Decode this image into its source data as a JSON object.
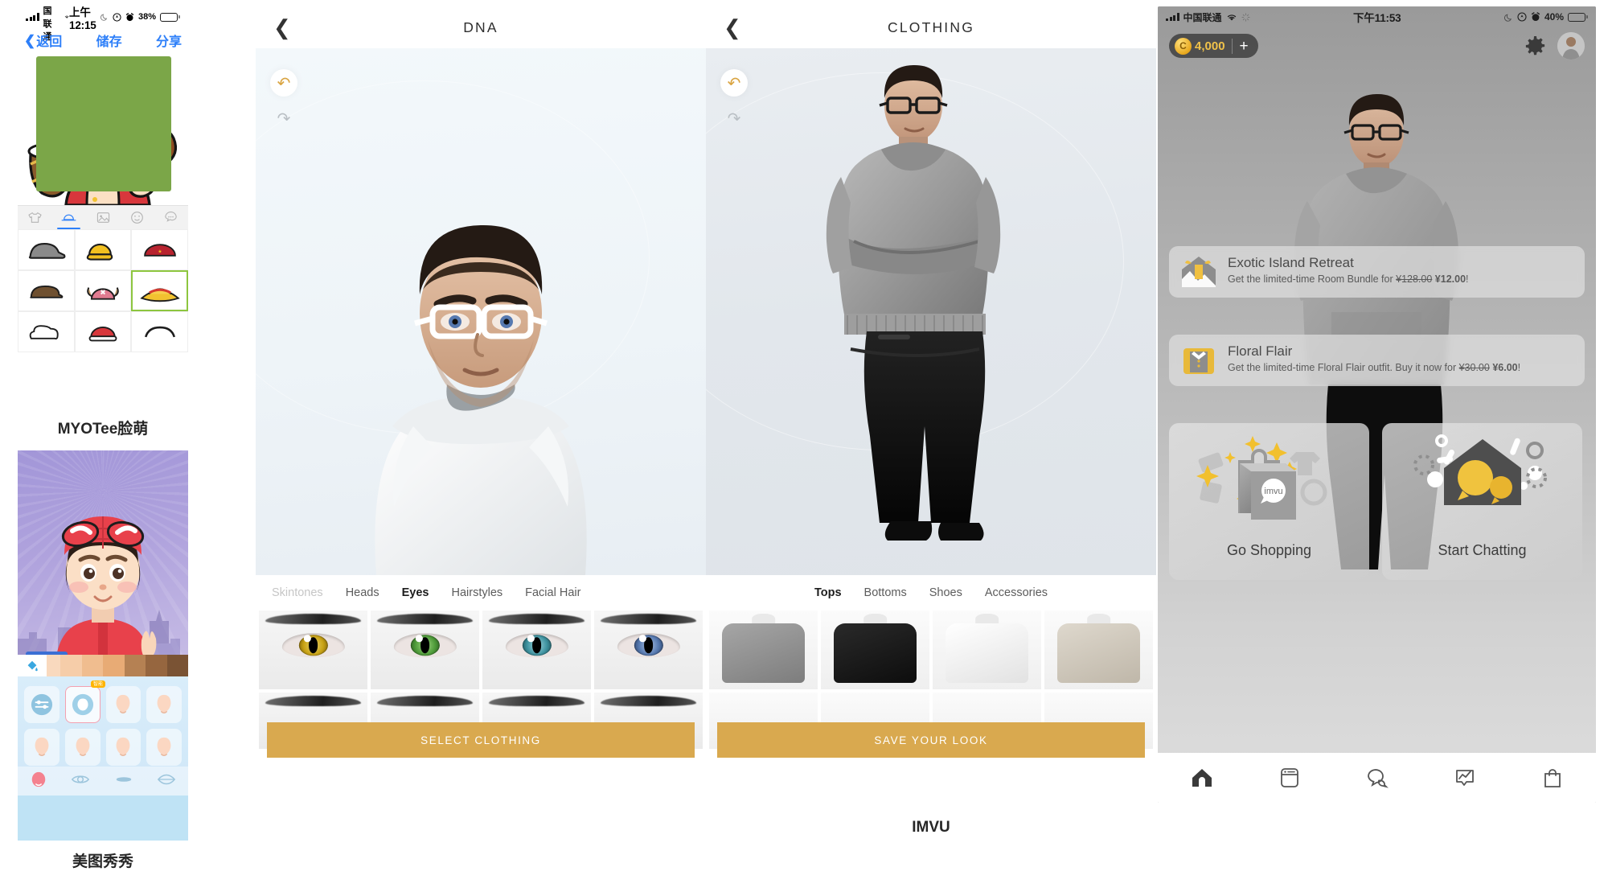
{
  "panels": {
    "myotee": {
      "app_label": "MYOTee脸萌",
      "statusbar": {
        "carrier": "中国联通",
        "time": "上午12:15",
        "battery": "38%"
      },
      "nav": {
        "back": "返回",
        "save": "储存",
        "share": "分享"
      },
      "tabs": [
        {
          "icon": "shirt-icon",
          "active": false
        },
        {
          "icon": "hat-icon",
          "active": true
        },
        {
          "icon": "image-icon",
          "active": false
        },
        {
          "icon": "face-icon",
          "active": false
        },
        {
          "icon": "speech-bubble-icon",
          "active": false
        }
      ],
      "items": [
        {
          "name": "grey-flat-cap",
          "selected": false
        },
        {
          "name": "yellow-ball-cap",
          "selected": false
        },
        {
          "name": "red-cap",
          "selected": false
        },
        {
          "name": "brown-newsboy-cap",
          "selected": false
        },
        {
          "name": "pink-reindeer-hat",
          "selected": false
        },
        {
          "name": "straw-hat",
          "selected": true
        },
        {
          "name": "white-fluffy-hat",
          "selected": false
        },
        {
          "name": "red-white-beanie",
          "selected": false
        },
        {
          "name": "black-headband",
          "selected": false
        }
      ]
    },
    "meitu": {
      "app_label": "美图秀秀",
      "bucket_icon": "paint-bucket-icon",
      "swatches": [
        "#fbe2cd",
        "#f9d9be",
        "#f6cda9",
        "#f0bd8f",
        "#e8ab75",
        "#b58153",
        "#96663f",
        "#7a5334"
      ],
      "items": [
        {
          "icon": "sliders-icon",
          "selected": false,
          "badge": ""
        },
        {
          "icon": "face-shape-icon",
          "selected": true,
          "badge": "智能"
        },
        {
          "icon": "face-shape-icon",
          "selected": false,
          "badge": ""
        },
        {
          "icon": "face-shape-icon",
          "selected": false,
          "badge": ""
        },
        {
          "icon": "face-shape-icon",
          "selected": false,
          "badge": ""
        },
        {
          "icon": "face-shape-icon",
          "selected": false,
          "badge": ""
        },
        {
          "icon": "face-shape-icon",
          "selected": false,
          "badge": ""
        },
        {
          "icon": "face-shape-icon",
          "selected": false,
          "badge": ""
        }
      ],
      "bottom_tabs": [
        {
          "icon": "face-icon",
          "active": true
        },
        {
          "icon": "eye-icon",
          "active": false
        },
        {
          "icon": "mouth-icon",
          "active": false
        },
        {
          "icon": "lips-icon",
          "active": false
        }
      ]
    },
    "dna": {
      "title": "DNA",
      "back_icon": "chevron-left-icon",
      "undo_icon": "undo-icon",
      "redo_icon": "redo-icon",
      "tabs": [
        {
          "label": "Skintones",
          "active": false,
          "muted": true
        },
        {
          "label": "Heads",
          "active": false,
          "muted": false
        },
        {
          "label": "Eyes",
          "active": true,
          "muted": false
        },
        {
          "label": "Hairstyles",
          "active": false,
          "muted": false
        },
        {
          "label": "Facial Hair",
          "active": false,
          "muted": false
        }
      ],
      "eye_options": [
        {
          "name": "gold-eye",
          "iris": "#c8a215",
          "selected": false
        },
        {
          "name": "green-eye",
          "iris": "#4f9c3a",
          "selected": false
        },
        {
          "name": "teal-eye",
          "iris": "#3f93a0",
          "selected": false
        },
        {
          "name": "blue-eye",
          "iris": "#5679b0",
          "selected": true
        }
      ],
      "cta": "SELECT CLOTHING",
      "cta_color": "#d9a94f"
    },
    "clothing": {
      "title": "CLOTHING",
      "app_label": "IMVU",
      "back_icon": "chevron-left-icon",
      "undo_icon": "undo-icon",
      "redo_icon": "redo-icon",
      "tabs": [
        {
          "label": "Tops",
          "active": true
        },
        {
          "label": "Bottoms",
          "active": false
        },
        {
          "label": "Shoes",
          "active": false
        },
        {
          "label": "Accessories",
          "active": false
        }
      ],
      "top_options": [
        {
          "name": "grey-hoodie",
          "color": "#8f8f8f",
          "selected": true
        },
        {
          "name": "black-jacket",
          "color": "#1c1c1c",
          "selected": false
        },
        {
          "name": "white-shirt",
          "color": "#f2f2f2",
          "selected": false
        },
        {
          "name": "beige-cardigan",
          "color": "#cfc9bf",
          "selected": false
        }
      ],
      "cta": "SAVE YOUR LOOK",
      "cta_color": "#d9a94f"
    },
    "home": {
      "statusbar": {
        "carrier": "中国联通",
        "time": "下午11:53",
        "battery": "40%"
      },
      "credits": {
        "value": "4,000",
        "coin_icon": "coin-icon",
        "plus_label": "+"
      },
      "settings_icon": "gear-icon",
      "avatar_icon": "avatar",
      "promos": [
        {
          "icon": "gift-house-icon",
          "title": "Exotic Island Retreat",
          "prefix": "Get the limited-time Room Bundle for ",
          "old_price": "¥128.00",
          "new_price": "¥12.00",
          "suffix": "!"
        },
        {
          "icon": "outfit-box-icon",
          "title": "Floral Flair",
          "prefix": "Get the limited-time Floral Flair outfit. Buy it now for ",
          "old_price": "¥30.00",
          "new_price": "¥6.00",
          "suffix": "!"
        }
      ],
      "tiles": [
        {
          "label": "Go Shopping",
          "icon": "shopping-bag-icon"
        },
        {
          "label": "Start Chatting",
          "icon": "chat-house-icon"
        }
      ],
      "tabbar": [
        {
          "icon": "home-icon",
          "active": true
        },
        {
          "icon": "feed-icon",
          "active": false
        },
        {
          "icon": "chat-icon",
          "active": false
        },
        {
          "icon": "trending-icon",
          "active": false
        },
        {
          "icon": "shop-bag-icon",
          "active": false
        }
      ]
    }
  }
}
